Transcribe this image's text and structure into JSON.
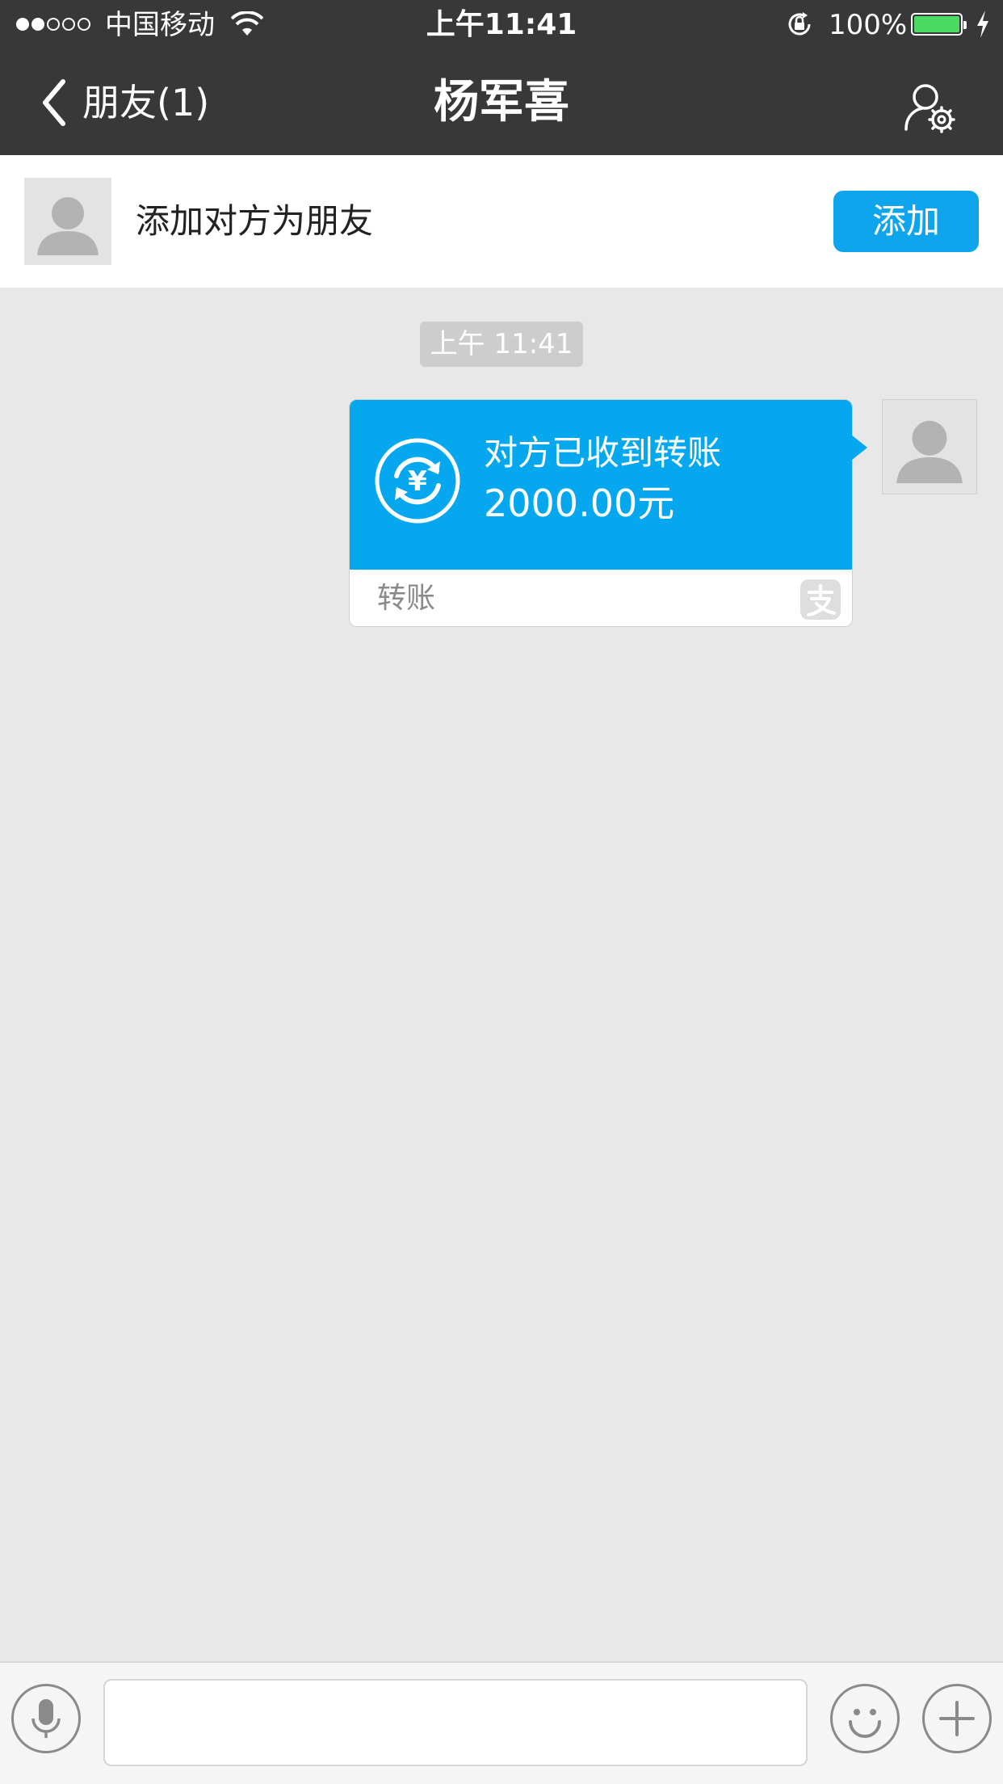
{
  "status_bar": {
    "carrier": "中国移动",
    "time": "上午11:41",
    "battery_percent": "100%",
    "signal_bars_filled": 2,
    "signal_bars_total": 5
  },
  "nav": {
    "back_label": "朋友(1)",
    "title": "杨军喜",
    "settings_icon": "contact-settings-icon"
  },
  "add_friend_banner": {
    "text": "添加对方为朋友",
    "button_label": "添加"
  },
  "chat": {
    "timestamp": "上午 11:41",
    "transfer": {
      "title": "对方已收到转账",
      "amount": "2000.00元",
      "label": "转账",
      "brand_icon": "alipay-icon"
    }
  },
  "input_bar": {
    "placeholder": "",
    "voice_icon": "microphone-icon",
    "emoji_icon": "smiley-icon",
    "more_icon": "plus-icon"
  },
  "colors": {
    "header_bg": "#383838",
    "accent": "#05a8ef",
    "button_blue": "#0ea5ec",
    "chat_bg": "#e8e8e9",
    "battery_green": "#4cd964"
  }
}
